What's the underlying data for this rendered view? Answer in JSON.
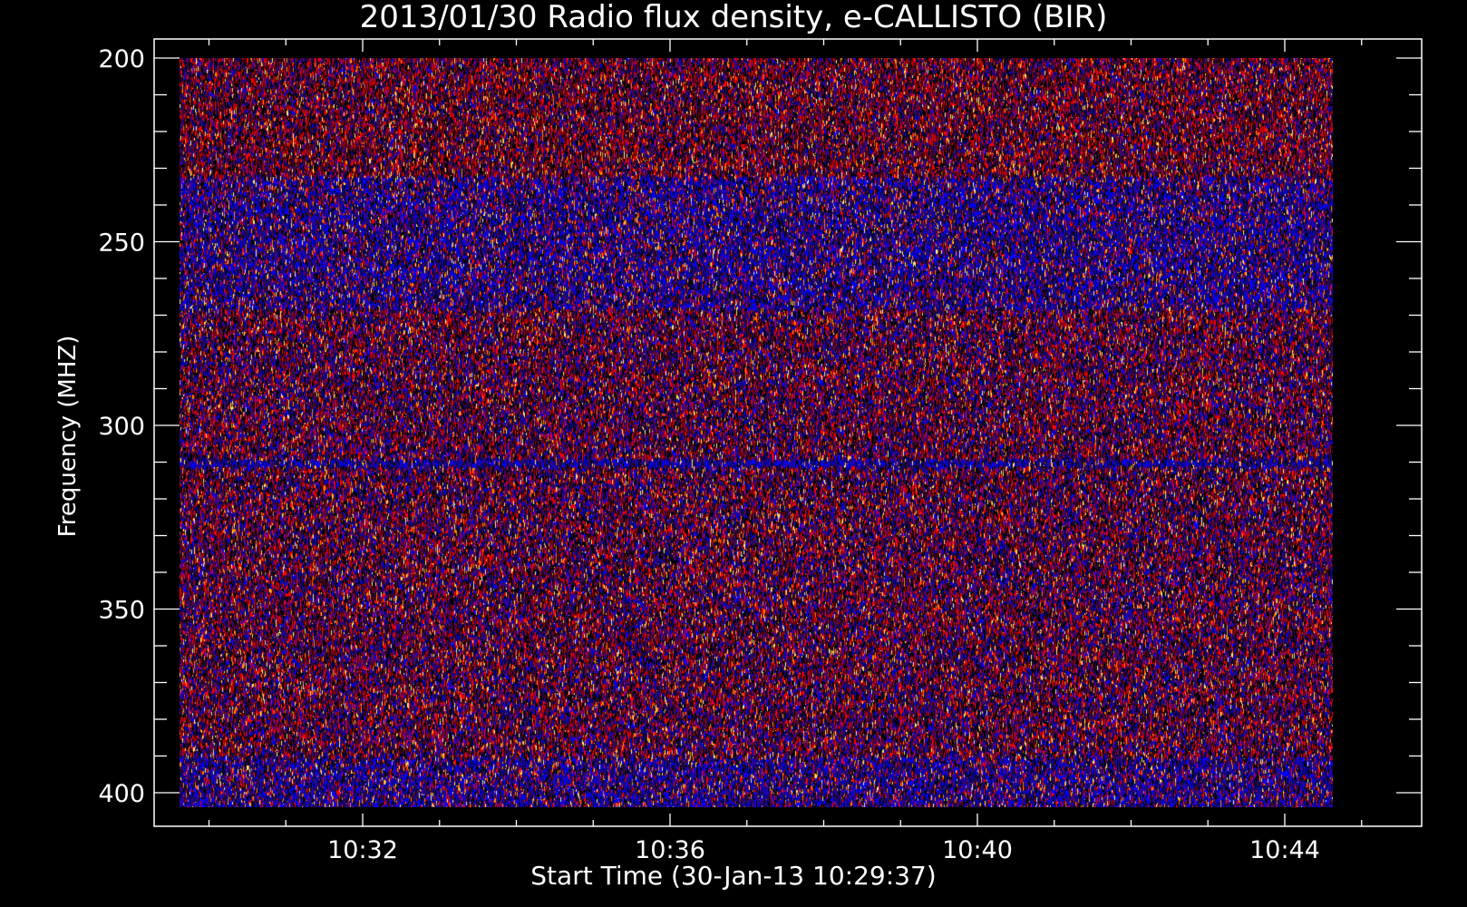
{
  "chart_data": {
    "type": "heatmap",
    "title": "2013/01/30  Radio flux density, e-CALLISTO (BIR)",
    "xlabel": "Start Time (30-Jan-13 10:29:37)",
    "ylabel": "Frequency (MHZ)",
    "x_tick_labels": [
      "10:32",
      "10:36",
      "10:40",
      "10:44"
    ],
    "x_tick_minutes": [
      32,
      36,
      40,
      44
    ],
    "xlim_minutes": [
      29.62,
      45.0
    ],
    "y_tick_labels": [
      "200",
      "250",
      "300",
      "350",
      "400"
    ],
    "y_tick_values": [
      200,
      250,
      300,
      350,
      400
    ],
    "ylim": [
      195,
      409
    ],
    "y_inverted": true,
    "data_extent": {
      "time_minutes": [
        29.62,
        44.62
      ],
      "frequency_mhz": [
        200,
        404
      ]
    },
    "grid": false,
    "colormap": [
      "#000000",
      "#1a0a3a",
      "#3a0a6a",
      "#0000ff",
      "#8a0000",
      "#ff0000",
      "#ff8800",
      "#ffee77"
    ],
    "bands": [
      {
        "from_mhz": 200,
        "to_mhz": 232,
        "character": "dark purple noise"
      },
      {
        "from_mhz": 232,
        "to_mhz": 268,
        "character": "enhanced blue band"
      },
      {
        "from_mhz": 268,
        "to_mhz": 300,
        "character": "red/purple noise"
      },
      {
        "from_mhz": 309,
        "to_mhz": 311,
        "character": "blue line"
      },
      {
        "from_mhz": 311,
        "to_mhz": 388,
        "character": "red/purple noise"
      },
      {
        "from_mhz": 390,
        "to_mhz": 404,
        "character": "enhanced blue band"
      }
    ]
  },
  "colors": {
    "background": "#000000",
    "axes": "#ffffff",
    "text": "#ffffff"
  }
}
